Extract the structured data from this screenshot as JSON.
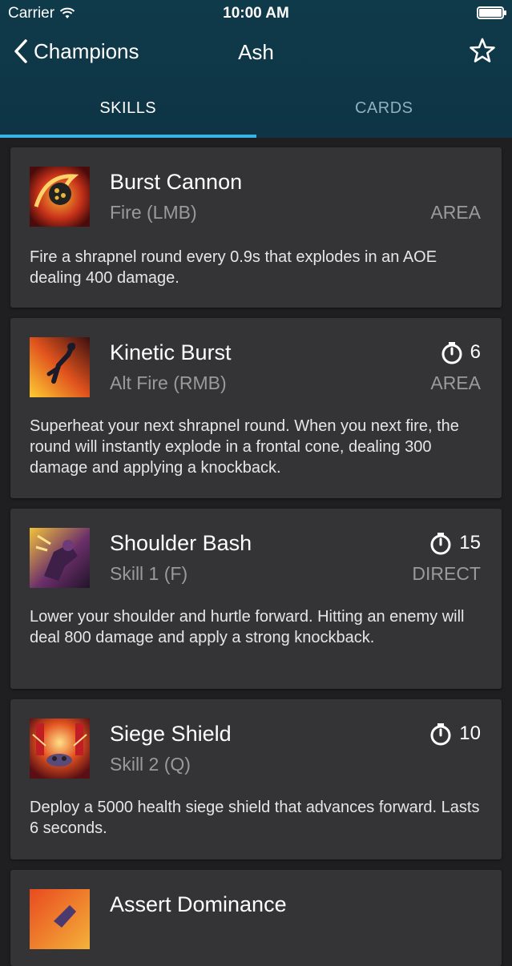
{
  "status_bar": {
    "carrier": "Carrier",
    "time": "10:00 AM"
  },
  "nav": {
    "back_label": "Champions",
    "title": "Ash"
  },
  "tabs": [
    {
      "label": "SKILLS",
      "active": true
    },
    {
      "label": "CARDS",
      "active": false
    }
  ],
  "skills": [
    {
      "name": "Burst Cannon",
      "key": "Fire (LMB)",
      "cooldown": "",
      "type": "AREA",
      "description": "Fire a shrapnel round every 0.9s that explodes in an AOE dealing 400 damage."
    },
    {
      "name": "Kinetic Burst",
      "key": "Alt Fire (RMB)",
      "cooldown": "6",
      "type": "AREA",
      "description": "Superheat your next shrapnel round. When you next fire, the round will instantly explode in a frontal cone, dealing 300 damage and applying a knockback."
    },
    {
      "name": "Shoulder Bash",
      "key": "Skill 1 (F)",
      "cooldown": "15",
      "type": "DIRECT",
      "description": "Lower your shoulder and hurtle forward. Hitting an enemy will deal 800 damage and apply a strong knockback."
    },
    {
      "name": "Siege Shield",
      "key": "Skill 2 (Q)",
      "cooldown": "10",
      "type": "",
      "description": "Deploy a 5000 health siege shield that advances forward. Lasts 6 seconds."
    },
    {
      "name": "Assert Dominance",
      "key": "",
      "cooldown": "",
      "type": "",
      "description": ""
    }
  ],
  "colors": {
    "header": "#0f3a4a",
    "tab_indicator": "#33b5e5",
    "card": "#343436",
    "background": "#1f1f22"
  }
}
